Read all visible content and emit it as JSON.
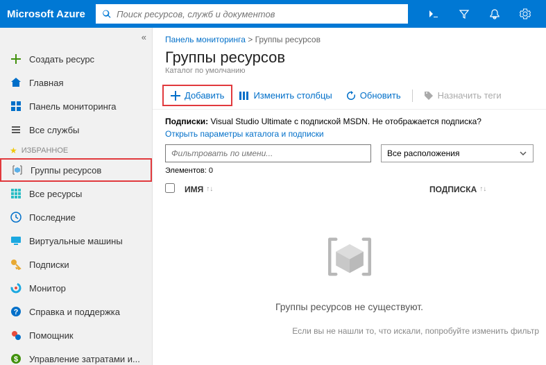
{
  "logo": "Microsoft Azure",
  "search": {
    "placeholder": "Поиск ресурсов, служб и документов"
  },
  "sidebar": {
    "collapse": "«",
    "items": [
      {
        "label": "Создать ресурс",
        "icon": "plus",
        "color": "#41910c"
      },
      {
        "label": "Главная",
        "icon": "home",
        "color": "#006fc9"
      },
      {
        "label": "Панель мониторинга",
        "icon": "dashboard",
        "color": "#006fc9"
      },
      {
        "label": "Все службы",
        "icon": "list",
        "color": "#555"
      }
    ],
    "favorites_label": "Избранное",
    "favorites": [
      {
        "label": "Группы ресурсов",
        "icon": "cube-brackets",
        "highlighted": true
      },
      {
        "label": "Все ресурсы",
        "icon": "grid",
        "color": "#2cbdc5"
      },
      {
        "label": "Последние",
        "icon": "clock",
        "color": "#006fc9"
      },
      {
        "label": "Виртуальные машины",
        "icon": "vm",
        "color": "#1ba8e0"
      },
      {
        "label": "Подписки",
        "icon": "key",
        "color": "#e8a933"
      },
      {
        "label": "Монитор",
        "icon": "monitor",
        "color": "#1ba8e0"
      },
      {
        "label": "Справка и поддержка",
        "icon": "help",
        "color": "#006fc9"
      },
      {
        "label": "Помощник",
        "icon": "advisor",
        "color": "#006fc9"
      },
      {
        "label": "Управление затратами и...",
        "icon": "cost",
        "color": "#41910c"
      }
    ]
  },
  "breadcrumb": {
    "parent": "Панель мониторинга",
    "sep": " > ",
    "current": "Группы ресурсов"
  },
  "page": {
    "title": "Группы ресурсов",
    "subtitle": "Каталог по умолчанию"
  },
  "toolbar": {
    "add": "Добавить",
    "columns": "Изменить столбцы",
    "refresh": "Обновить",
    "tags": "Назначить теги"
  },
  "subscriptions": {
    "label": "Подписки:",
    "value": "Visual Studio Ultimate с подпиской MSDN. Не отображается подписка?",
    "link": "Открыть параметры каталога и подписки"
  },
  "filters": {
    "name_placeholder": "Фильтровать по имени...",
    "location": "Все расположения"
  },
  "count": {
    "label": "Элементов:",
    "value": "0"
  },
  "table": {
    "col_name": "имя",
    "col_sub": "подписка"
  },
  "empty": {
    "title": "Группы ресурсов не существуют.",
    "hint": "Если вы не нашли то, что искали, попробуйте изменить фильтр"
  }
}
